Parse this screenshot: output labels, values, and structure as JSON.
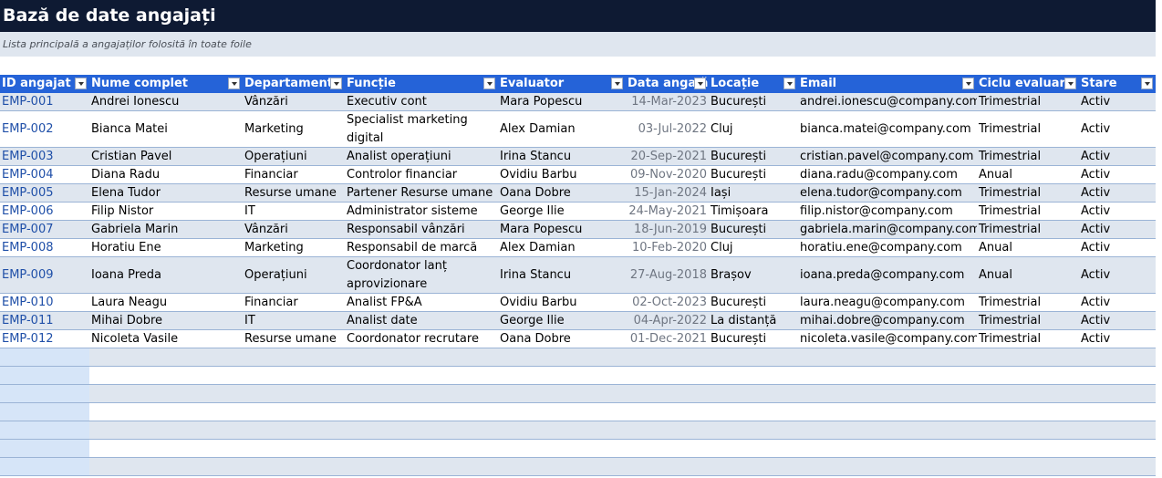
{
  "sheet": {
    "title": "Bază de date angajați",
    "subtitle": "Lista principală a angajaților folosită în toate foile"
  },
  "table": {
    "headers": [
      "ID angajat",
      "Nume complet",
      "Departament",
      "Funcție",
      "Evaluator",
      "Data angajă",
      "Locație",
      "Email",
      "Ciclu evaluare",
      "Stare"
    ],
    "rows": [
      [
        "EMP-001",
        "Andrei Ionescu",
        "Vânzări",
        "Executiv cont",
        "Mara Popescu",
        "14-Mar-2023",
        "București",
        "andrei.ionescu@company.com",
        "Trimestrial",
        "Activ"
      ],
      [
        "EMP-002",
        "Bianca Matei",
        "Marketing",
        "Specialist marketing digital",
        "Alex Damian",
        "03-Jul-2022",
        "Cluj",
        "bianca.matei@company.com",
        "Trimestrial",
        "Activ"
      ],
      [
        "EMP-003",
        "Cristian Pavel",
        "Operațiuni",
        "Analist operațiuni",
        "Irina Stancu",
        "20-Sep-2021",
        "București",
        "cristian.pavel@company.com",
        "Trimestrial",
        "Activ"
      ],
      [
        "EMP-004",
        "Diana Radu",
        "Financiar",
        "Controlor financiar",
        "Ovidiu Barbu",
        "09-Nov-2020",
        "București",
        "diana.radu@company.com",
        "Anual",
        "Activ"
      ],
      [
        "EMP-005",
        "Elena Tudor",
        "Resurse umane",
        "Partener Resurse umane",
        "Oana Dobre",
        "15-Jan-2024",
        "Iași",
        "elena.tudor@company.com",
        "Trimestrial",
        "Activ"
      ],
      [
        "EMP-006",
        "Filip Nistor",
        "IT",
        "Administrator sisteme",
        "George Ilie",
        "24-May-2021",
        "Timișoara",
        "filip.nistor@company.com",
        "Trimestrial",
        "Activ"
      ],
      [
        "EMP-007",
        "Gabriela Marin",
        "Vânzări",
        "Responsabil vânzări",
        "Mara Popescu",
        "18-Jun-2019",
        "București",
        "gabriela.marin@company.com",
        "Trimestrial",
        "Activ"
      ],
      [
        "EMP-008",
        "Horatiu Ene",
        "Marketing",
        "Responsabil de marcă",
        "Alex Damian",
        "10-Feb-2020",
        "Cluj",
        "horatiu.ene@company.com",
        "Anual",
        "Activ"
      ],
      [
        "EMP-009",
        "Ioana Preda",
        "Operațiuni",
        "Coordonator lanț aprovizionare",
        "Irina Stancu",
        "27-Aug-2018",
        "Brașov",
        "ioana.preda@company.com",
        "Anual",
        "Activ"
      ],
      [
        "EMP-010",
        "Laura Neagu",
        "Financiar",
        "Analist FP&A",
        "Ovidiu Barbu",
        "02-Oct-2023",
        "București",
        "laura.neagu@company.com",
        "Trimestrial",
        "Activ"
      ],
      [
        "EMP-011",
        "Mihai Dobre",
        "IT",
        "Analist date",
        "George Ilie",
        "04-Apr-2022",
        "La distanță",
        "mihai.dobre@company.com",
        "Trimestrial",
        "Activ"
      ],
      [
        "EMP-012",
        "Nicoleta Vasile",
        "Resurse umane",
        "Coordonator recrutare",
        "Oana Dobre",
        "01-Dec-2021",
        "București",
        "nicoleta.vasile@company.com",
        "Trimestrial",
        "Activ"
      ]
    ]
  },
  "colors": {
    "title_bg": "#0e1a33",
    "header_bg": "#2563d8",
    "band": "#dfe6ef",
    "id_text": "#1f4fa8"
  },
  "icons": {
    "filter": "filter-dropdown-icon"
  }
}
